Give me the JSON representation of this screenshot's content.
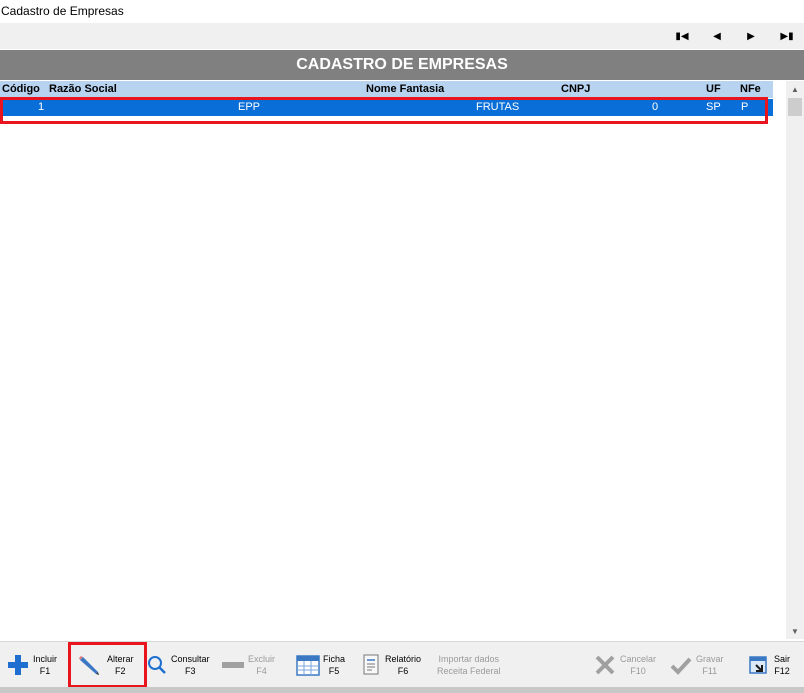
{
  "window": {
    "title": "Cadastro de Empresas"
  },
  "nav": {
    "first": "▮◀",
    "prev": "◀",
    "next": "▶",
    "last": "▶▮"
  },
  "header": {
    "title": "CADASTRO DE EMPRESAS"
  },
  "table": {
    "columns": [
      "Código",
      "Razão Social",
      "Nome Fantasia",
      "CNPJ",
      "UF",
      "NFe"
    ],
    "rows": [
      {
        "codigo": "1",
        "razao": "EPP",
        "fantasia": "FRUTAS",
        "cnpj": "0",
        "uf": "SP",
        "nfe": "P"
      }
    ]
  },
  "toolbar": {
    "incluir": {
      "label": "Incluir",
      "key": "F1"
    },
    "alterar": {
      "label": "Alterar",
      "key": "F2"
    },
    "consultar": {
      "label": "Consultar",
      "key": "F3"
    },
    "excluir": {
      "label": "Excluir",
      "key": "F4"
    },
    "ficha": {
      "label": "Ficha",
      "key": "F5"
    },
    "relatorio": {
      "label": "Relatório",
      "key": "F6"
    },
    "importar": {
      "label": "Importar dados",
      "key": "Receita Federal"
    },
    "cancelar": {
      "label": "Cancelar",
      "key": "F10"
    },
    "gravar": {
      "label": "Gravar",
      "key": "F11"
    },
    "sair": {
      "label": "Sair",
      "key": "F12"
    }
  },
  "colors": {
    "accent": "#0a6ed8",
    "header": "#808080",
    "colhead": "#b7d3f0",
    "highlight": "#e8141e"
  }
}
